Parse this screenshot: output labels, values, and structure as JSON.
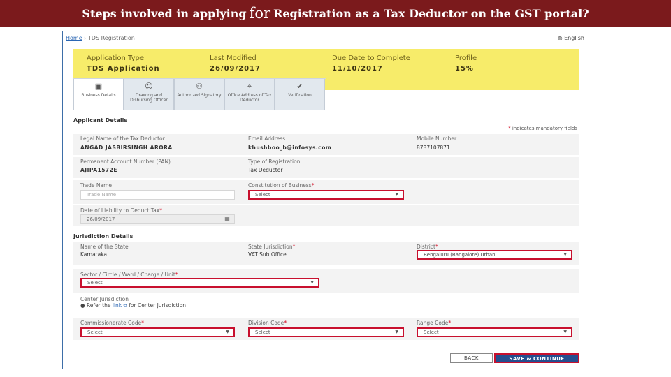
{
  "slide": {
    "title_before": "Steps involved in applying",
    "title_big": "for",
    "title_after": "Registration as a Tax Deductor on the GST portal?"
  },
  "breadcrumb": {
    "home": "Home",
    "separator": "›",
    "current": "TDS Registration"
  },
  "language": {
    "icon": "globe-icon",
    "label": "English"
  },
  "summary": {
    "application_type_label": "Application Type",
    "application_type_value": "TDS Application",
    "last_modified_label": "Last Modified",
    "last_modified_value": "26/09/2017",
    "due_date_label": "Due Date to Complete",
    "due_date_value": "11/10/2017",
    "profile_label": "Profile",
    "profile_value": "15%"
  },
  "tabs": [
    {
      "label": "Business Details",
      "icon": "briefcase-icon"
    },
    {
      "label": "Drawing and Disbursing Officer",
      "icon": "person-icon"
    },
    {
      "label": "Authorized Signatory",
      "icon": "people-icon"
    },
    {
      "label": "Office Address of Tax Deductor",
      "icon": "location-pin-icon"
    },
    {
      "label": "Verification",
      "icon": "checkmark-icon"
    }
  ],
  "applicant": {
    "section_title": "Applicant Details",
    "mandatory_note": "indicates mandatory fields",
    "legal_name_label": "Legal Name of the Tax Deductor",
    "legal_name_value": "ANGAD JASBIRSINGH ARORA",
    "email_label": "Email Address",
    "email_value": "khushboo_b@infosys.com",
    "mobile_label": "Mobile Number",
    "mobile_value": "8787107871",
    "pan_label": "Permanent Account Number (PAN)",
    "pan_value": "AJIPA1572E",
    "reg_type_label": "Type of Registration",
    "reg_type_value": "Tax Deductor",
    "trade_name_label": "Trade Name",
    "trade_name_placeholder": "Trade Name",
    "constitution_label": "Constitution of Business",
    "constitution_value": "Select",
    "liability_date_label": "Date of Liability to Deduct Tax",
    "liability_date_value": "26/09/2017"
  },
  "jurisdiction": {
    "section_title": "Jurisdiction Details",
    "state_label": "Name of the State",
    "state_value": "Karnataka",
    "state_jurisdiction_label": "State Jurisdiction",
    "state_jurisdiction_value": "VAT Sub Office",
    "district_label": "District",
    "district_value": "Bengaluru (Bangalore) Urban",
    "sector_label": "Sector / Circle / Ward / Charge / Unit",
    "sector_value": "Select",
    "center_label": "Center Jurisdiction",
    "refer_text_before": "Refer the",
    "refer_link": "link",
    "refer_text_after": "for Center Jurisdiction",
    "commissionerate_label": "Commissionerate Code",
    "commissionerate_value": "Select",
    "division_label": "Division Code",
    "division_value": "Select",
    "range_label": "Range Code",
    "range_value": "Select"
  },
  "buttons": {
    "back": "BACK",
    "save": "SAVE & CONTINUE"
  },
  "colors": {
    "title_bar": "#7b1a1c",
    "summary_bg": "#f7ec6a",
    "highlight": "#c8102e",
    "primary_button": "#254e8f"
  }
}
